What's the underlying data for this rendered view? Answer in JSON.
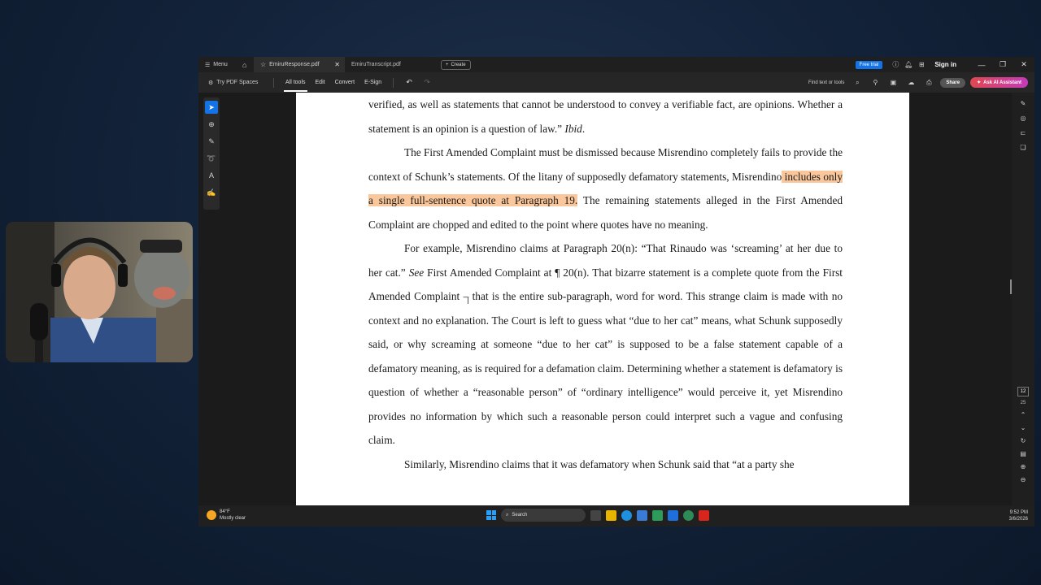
{
  "window": {
    "menu_label": "Menu",
    "tabs": [
      {
        "label": "EmiruResponse.pdf",
        "active": true
      },
      {
        "label": "EmiruTranscript.pdf",
        "active": false
      }
    ],
    "create_label": "Create",
    "free_trial_label": "Free trial",
    "sign_in_label": "Sign in"
  },
  "toolbar": {
    "pdf_spaces_label": "Try PDF Spaces",
    "menus": [
      "All tools",
      "Edit",
      "Convert",
      "E-Sign"
    ],
    "active_menu": "All tools",
    "find_label": "Find text or tools",
    "share_label": "Share",
    "ai_label": "Ask AI Assistant"
  },
  "document": {
    "p1": "verified, as well as statements that cannot be understood to convey a verifiable fact, are opinions. Whether a statement is an opinion is a question of law.”",
    "p1_cite": "Ibid",
    "p2_a": "The First Amended Complaint must be dismissed because Misrendino completely fails to provide the context of Schunk’s statements.  Of the litany of supposedly defamatory statements, Misrendino",
    "p2_hl": " includes only a single full-sentence quote at Paragraph 19.",
    "p2_b": "  The remaining statements alleged in the First Amended Complaint are chopped and edited to the point where quotes have no meaning.",
    "p3_a": "For example, Misrendino claims at Paragraph 20(n): “That Rinaudo was ‘screaming’ at her due to her cat.”  ",
    "p3_see": "See",
    "p3_b": " First Amended Complaint at ¶ 20(n).  That bizarre statement is a complete quote from the First Amended Complaint – that is the entire sub-paragraph, word for word.  This strange claim is made with no context and no explanation.  The Court is left to guess what “due to her cat” means, what Schunk supposedly said, or why screaming at someone “due to her cat” is supposed to be a false statement capable of a defamatory meaning, as is required for a defamation claim.  Determining whether a statement is defamatory is question of whether a “reasonable person” of “ordinary intelligence” would perceive it, yet Misrendino provides no information by which such a reasonable person could interpret such a vague and confusing claim.",
    "p4": "Similarly, Misrendino claims that it was defamatory when Schunk said that “at a party she"
  },
  "page_nav": {
    "current": "12",
    "total": "25"
  },
  "taskbar": {
    "temperature": "84°F",
    "weather": "Mostly clear",
    "search_label": "Search",
    "time": "9:52 PM",
    "date": "3/6/2026"
  },
  "colors": {
    "highlight": "#f9c79b",
    "accent": "#1473e6",
    "ai_gradient_start": "#e0484f",
    "ai_gradient_end": "#c43abb"
  }
}
